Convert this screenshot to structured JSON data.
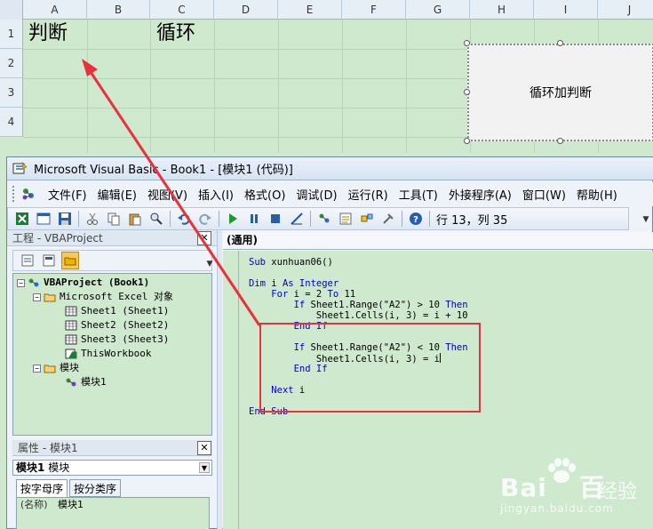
{
  "sheet": {
    "columns": [
      "A",
      "B",
      "C",
      "D",
      "E",
      "F",
      "G",
      "H",
      "I",
      "J"
    ],
    "rows": [
      "1",
      "2",
      "3",
      "4"
    ],
    "cells": {
      "a1": "判断",
      "c1": "循环"
    },
    "button_label": "循环加判断"
  },
  "vba": {
    "window_title": "Microsoft Visual Basic - Book1 - [模块1 (代码)]",
    "menu": [
      "文件(F)",
      "编辑(E)",
      "视图(V)",
      "插入(I)",
      "格式(O)",
      "调试(D)",
      "运行(R)",
      "工具(T)",
      "外接程序(A)",
      "窗口(W)",
      "帮助(H)"
    ],
    "toolbar_status": "行 13，列 35",
    "project_pane": {
      "title": "工程 - VBAProject",
      "tree": [
        {
          "label": "VBAProject (Book1)",
          "bold": true
        },
        {
          "label": "Microsoft Excel 对象"
        },
        {
          "label": "Sheet1 (Sheet1)"
        },
        {
          "label": "Sheet2 (Sheet2)"
        },
        {
          "label": "Sheet3 (Sheet3)"
        },
        {
          "label": "ThisWorkbook"
        },
        {
          "label": "模块"
        },
        {
          "label": "模块1"
        }
      ]
    },
    "properties_pane": {
      "title": "属性 - 模块1",
      "object_name": "模块1",
      "object_type": "模块",
      "tabs": [
        "按字母序",
        "按分类序"
      ],
      "row_name": "(名称)",
      "row_value": "模块1"
    },
    "code": {
      "procedure_box": "(通用)",
      "lines": [
        "Sub xunhuan06()",
        "",
        "Dim i As Integer",
        "    For i = 2 To 11",
        "        If Sheet1.Range(\"A2\") > 10 Then",
        "            Sheet1.Cells(i, 3) = i + 10",
        "        End If",
        "",
        "        If Sheet1.Range(\"A2\") < 10 Then",
        "            Sheet1.Cells(i, 3) = i",
        "        End If",
        "",
        "    Next i",
        "",
        "End Sub"
      ]
    }
  },
  "watermark": {
    "logo": "Bai",
    "logo_end": "百",
    "text": "经验",
    "sub": "jingyan.baidu.com"
  },
  "colors": {
    "annotation_red": "#e8313a",
    "sheet_bg": "#cfe9cf"
  }
}
